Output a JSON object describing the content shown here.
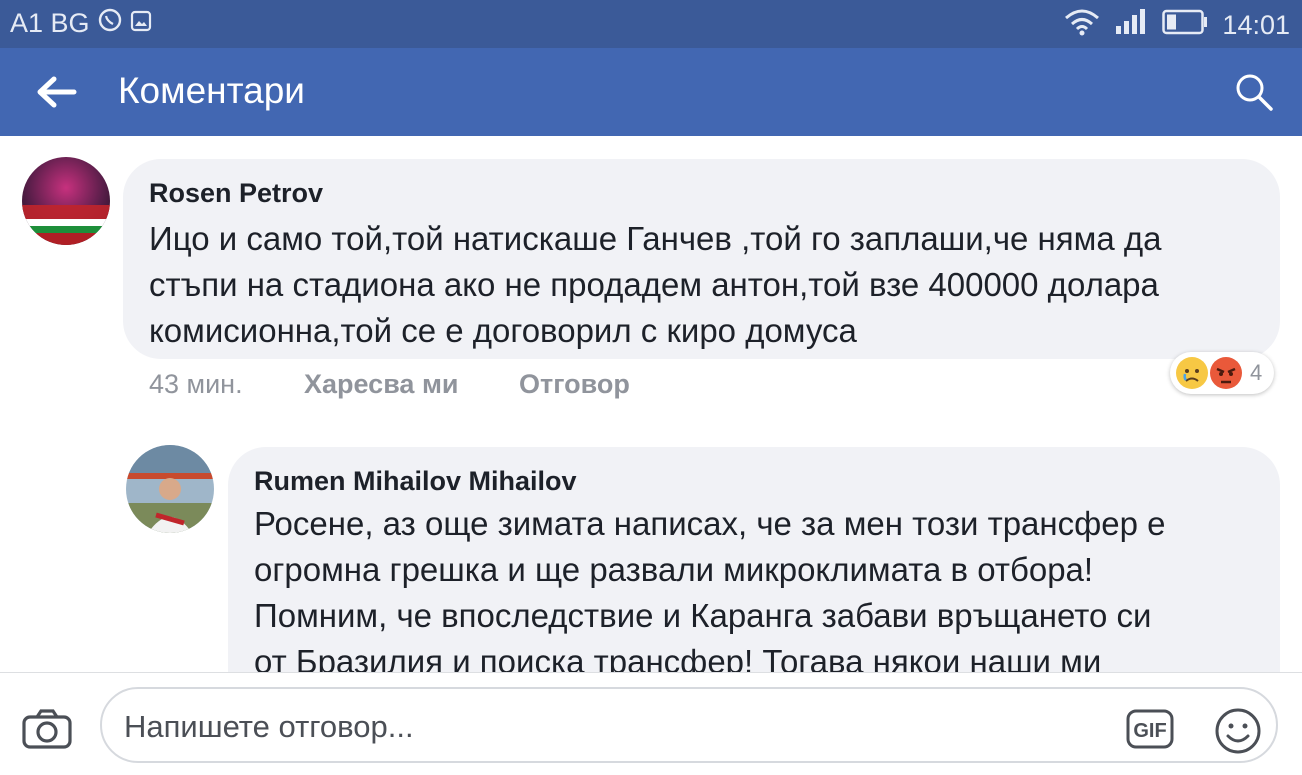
{
  "status_bar": {
    "carrier": "A1 BG",
    "time": "14:01",
    "icons": [
      "viber-icon",
      "image-icon",
      "wifi-icon",
      "signal-icon",
      "battery-icon"
    ]
  },
  "app_bar": {
    "title": "Коментари",
    "back_icon": "back-arrow-icon",
    "search_icon": "search-icon"
  },
  "comments": [
    {
      "author": "Rosen Petrov",
      "lines": [
        "Ицо и само той,той натискаше Ганчев ,той го заплаши,че няма да",
        "стъпи на стадиона ако не продадем антон,той взе 400000 долара",
        "комисионна,той се е договорил с киро домуса"
      ],
      "time": "43 мин.",
      "like_label": "Харесва ми",
      "reply_label": "Отговор",
      "reactions": {
        "icons": [
          "sad-emoji-icon",
          "angry-emoji-icon"
        ],
        "count": "4"
      }
    },
    {
      "author": "Rumen Mihailov Mihailov",
      "lines": [
        "Росене, аз още зимата написах, че за мен този трансфер е",
        "огромна грешка и ще развали микроклимата в отбора!",
        "Помним, че впоследствие и Каранга забави връщането си",
        "от Бразилия и поиска трансфер! Тогава някои наши ми"
      ]
    }
  ],
  "composer": {
    "placeholder": "Напишете отговор...",
    "gif_label": "GIF"
  },
  "colors": {
    "status_bar": "#3b5a98",
    "app_bar": "#4267b2",
    "bubble": "#f1f2f6",
    "meta_text": "#90949c"
  }
}
